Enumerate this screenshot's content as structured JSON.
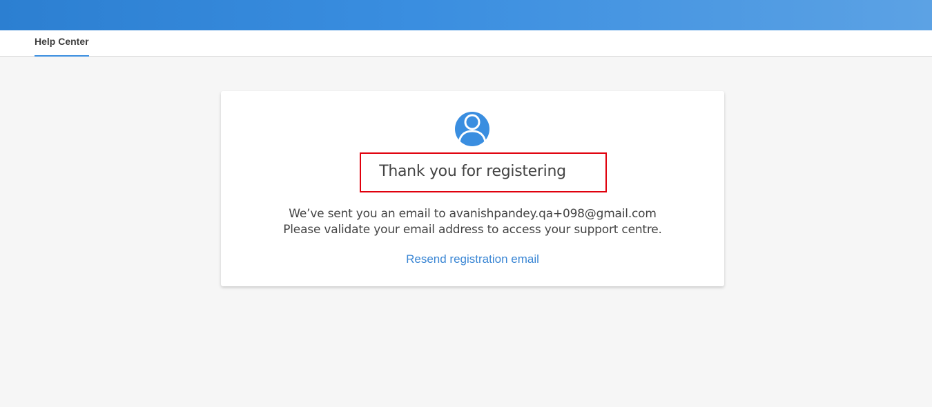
{
  "nav": {
    "tab_label": "Help Center"
  },
  "card": {
    "avatar_icon": "user-icon",
    "title": "Thank you for registering",
    "message_line1": "We’ve sent you an email to avanishpandey.qa+098@gmail.com",
    "message_line2": "Please validate your email address to access your support centre.",
    "resend_link": "Resend registration email"
  },
  "colors": {
    "accent": "#3a8ee0",
    "link": "#3a86d4",
    "highlight": "#e0000d",
    "background": "#f6f6f6"
  }
}
